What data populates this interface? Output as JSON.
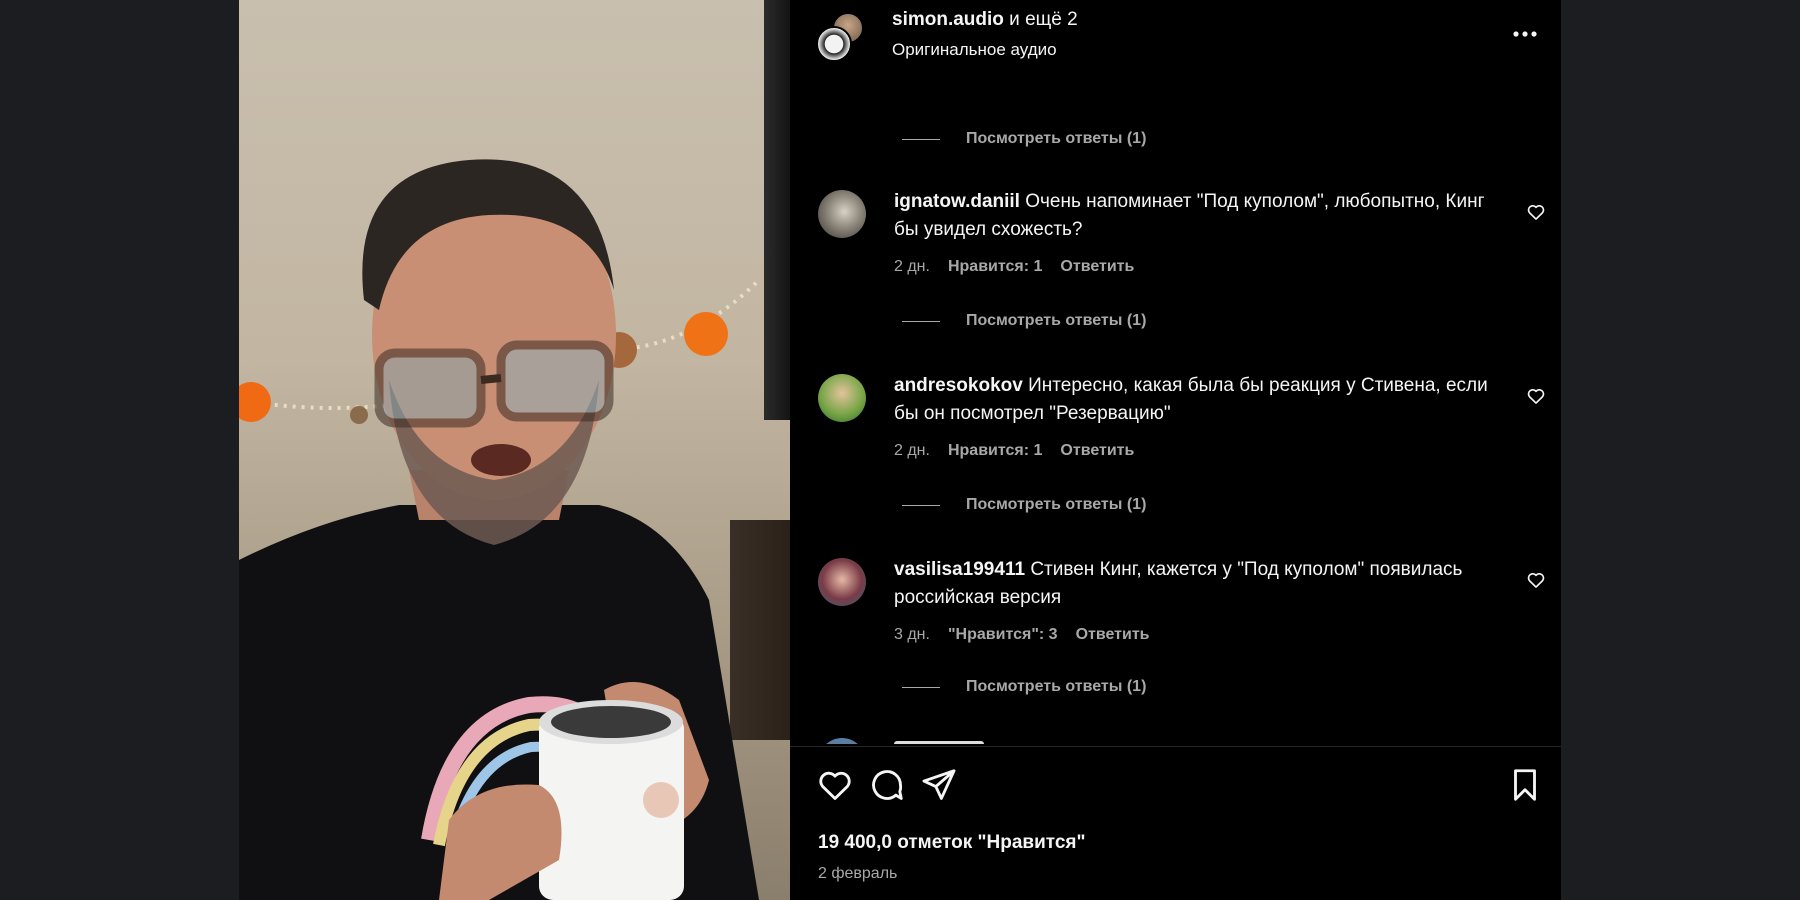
{
  "header": {
    "title_user": "simon.audio",
    "title_rest": " и ещё 2",
    "subtitle": "Оригинальное аудио",
    "more_icon": "more-horizontal-icon"
  },
  "comments": {
    "view_replies_label": "Посмотреть ответы (1)",
    "items": [
      {
        "user": "ignatow.daniil",
        "text": "Очень напоминает \"Под куполом\", любопытно, Кинг бы увидел схожесть?",
        "age": "2 дн.",
        "likes": "Нравится: 1",
        "reply": "Ответить"
      },
      {
        "user": "andresokokov",
        "text": "Интересно, какая была бы реакция у Стивена, если бы он посмотрел \"Резервацию\"",
        "age": "2 дн.",
        "likes": "Нравится: 1",
        "reply": "Ответить"
      },
      {
        "user": "vasilisa199411",
        "text": "Стивен Кинг, кажется у \"Под куполом\" появилась российская версия",
        "age": "3 дн.",
        "likes": "\"Нравится\": 3",
        "reply": "Ответить"
      }
    ]
  },
  "post": {
    "likes_count": "19 400,0 отметок \"Нравится\"",
    "date": "2 февраль"
  },
  "icons": {
    "like": "heart-icon",
    "comment": "comment-bubble-icon",
    "share": "paper-plane-icon",
    "save": "bookmark-icon"
  },
  "colors": {
    "panel_bg": "#000000",
    "page_bg": "#1c1d21",
    "text_primary": "#f5f5f5",
    "text_secondary": "#a8a8a8"
  }
}
